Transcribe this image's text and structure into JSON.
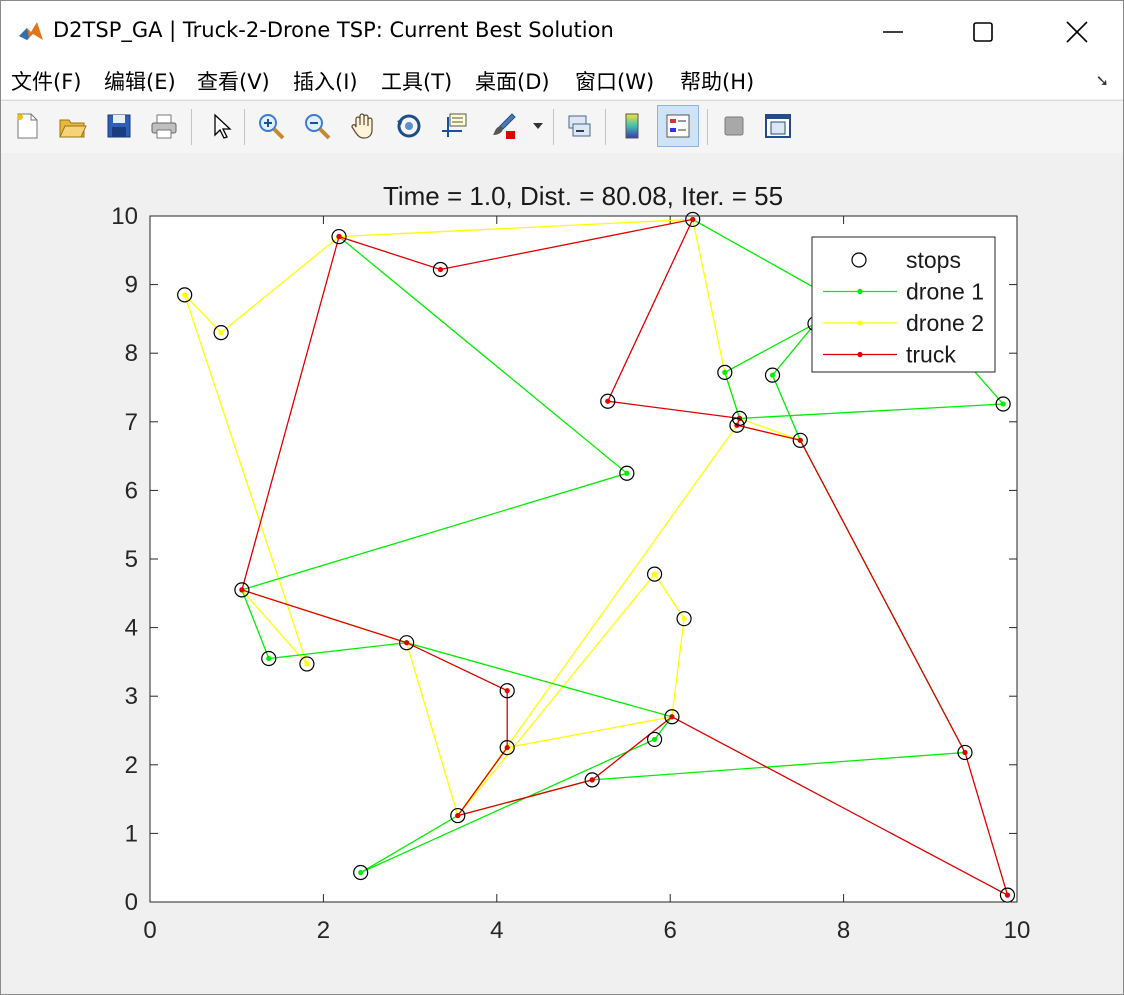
{
  "window": {
    "title": "D2TSP_GA | Truck-2-Drone TSP: Current Best Solution"
  },
  "menu": [
    {
      "label": "文件(F)",
      "name": "menu-file"
    },
    {
      "label": "编辑(E)",
      "name": "menu-edit"
    },
    {
      "label": "查看(V)",
      "name": "menu-view"
    },
    {
      "label": "插入(I)",
      "name": "menu-insert"
    },
    {
      "label": "工具(T)",
      "name": "menu-tools"
    },
    {
      "label": "桌面(D)",
      "name": "menu-desktop"
    },
    {
      "label": "窗口(W)",
      "name": "menu-window"
    },
    {
      "label": "帮助(H)",
      "name": "menu-help"
    }
  ],
  "toolbar": [
    "new-figure-icon",
    "open-file-icon",
    "save-icon",
    "print-icon",
    "pointer-icon",
    "zoom-in-icon",
    "zoom-out-icon",
    "pan-hand-icon",
    "rotate-3d-icon",
    "data-cursor-icon",
    "brush-icon",
    "link-plot-icon",
    "colorbar-icon",
    "legend-icon",
    "hide-plot-tools-icon",
    "show-plot-tools-icon"
  ],
  "colors": {
    "drone1": "#00ee00",
    "drone2": "#ffff00",
    "truck": "#e00000"
  },
  "chart_data": {
    "type": "line",
    "title": "Time = 1.0, Dist. = 80.08, Iter. = 55",
    "xlim": [
      0,
      10
    ],
    "ylim": [
      0,
      10
    ],
    "xticks": [
      "0",
      "2",
      "4",
      "6",
      "8",
      "10"
    ],
    "yticks": [
      "0",
      "1",
      "2",
      "3",
      "4",
      "5",
      "6",
      "7",
      "8",
      "9",
      "10"
    ],
    "grid": false,
    "legend_position": "top-right",
    "legend": [
      "stops",
      "drone 1",
      "drone 2",
      "truck"
    ],
    "stops": [
      [
        2.18,
        9.7
      ],
      [
        3.35,
        9.22
      ],
      [
        6.26,
        9.95
      ],
      [
        5.28,
        7.3
      ],
      [
        6.8,
        7.05
      ],
      [
        6.77,
        6.95
      ],
      [
        7.5,
        6.73
      ],
      [
        9.4,
        2.18
      ],
      [
        9.89,
        0.1
      ],
      [
        6.02,
        2.7
      ],
      [
        5.1,
        1.78
      ],
      [
        3.55,
        1.26
      ],
      [
        4.12,
        2.25
      ],
      [
        4.12,
        3.08
      ],
      [
        2.96,
        3.78
      ],
      [
        1.06,
        4.55
      ],
      [
        0.4,
        8.85
      ],
      [
        0.82,
        8.3
      ],
      [
        1.81,
        3.47
      ],
      [
        1.37,
        3.55
      ],
      [
        5.5,
        6.25
      ],
      [
        2.43,
        0.43
      ],
      [
        5.82,
        2.37
      ],
      [
        5.82,
        4.78
      ],
      [
        6.16,
        4.13
      ],
      [
        6.63,
        7.72
      ],
      [
        7.18,
        7.68
      ],
      [
        7.67,
        8.43
      ],
      [
        9.84,
        7.26
      ],
      [
        9.43,
        7.85
      ]
    ],
    "series": [
      {
        "name": "truck",
        "points": [
          [
            2.18,
            9.7
          ],
          [
            1.06,
            4.55
          ],
          [
            2.96,
            3.78
          ],
          [
            4.12,
            3.08
          ],
          [
            4.12,
            2.25
          ],
          [
            3.55,
            1.26
          ],
          [
            5.1,
            1.78
          ],
          [
            6.02,
            2.7
          ],
          [
            9.89,
            0.1
          ],
          [
            9.4,
            2.18
          ],
          [
            7.5,
            6.73
          ],
          [
            6.77,
            6.95
          ],
          [
            6.8,
            7.05
          ],
          [
            5.28,
            7.3
          ],
          [
            6.26,
            9.95
          ],
          [
            3.35,
            9.22
          ],
          [
            2.18,
            9.7
          ]
        ]
      },
      {
        "name": "drone 1",
        "points": [
          [
            2.18,
            9.7
          ],
          [
            5.5,
            6.25
          ],
          [
            1.06,
            4.55
          ],
          [
            1.37,
            3.55
          ],
          [
            2.96,
            3.78
          ],
          [
            6.02,
            2.7
          ],
          [
            5.82,
            2.37
          ],
          [
            2.43,
            0.43
          ],
          [
            3.55,
            1.26
          ],
          [
            5.1,
            1.78
          ],
          [
            9.4,
            2.18
          ],
          [
            7.5,
            6.73
          ],
          [
            7.18,
            7.68
          ],
          [
            7.67,
            8.43
          ],
          [
            6.63,
            7.72
          ],
          [
            6.8,
            7.05
          ],
          [
            9.84,
            7.26
          ],
          [
            9.43,
            7.85
          ],
          [
            7.67,
            8.95
          ],
          [
            6.26,
            9.95
          ]
        ]
      },
      {
        "name": "drone 2",
        "points": [
          [
            6.26,
            9.95
          ],
          [
            2.18,
            9.7
          ],
          [
            0.82,
            8.3
          ],
          [
            0.4,
            8.85
          ],
          [
            1.81,
            3.47
          ],
          [
            1.06,
            4.55
          ],
          [
            2.96,
            3.78
          ],
          [
            3.55,
            1.26
          ],
          [
            5.82,
            4.78
          ],
          [
            6.16,
            4.13
          ],
          [
            6.02,
            2.7
          ],
          [
            4.12,
            2.25
          ],
          [
            3.55,
            1.26
          ],
          [
            6.77,
            6.95
          ],
          [
            7.5,
            6.73
          ],
          [
            6.8,
            7.05
          ],
          [
            6.63,
            7.72
          ],
          [
            6.26,
            9.95
          ]
        ]
      }
    ]
  }
}
